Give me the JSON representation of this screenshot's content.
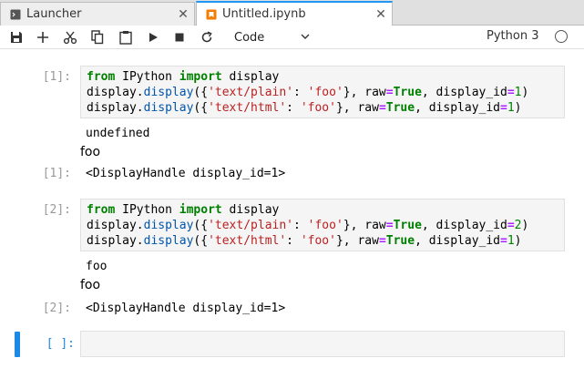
{
  "tabs": [
    {
      "label": "Launcher",
      "icon": "launcher-icon",
      "active": false
    },
    {
      "label": "Untitled.ipynb",
      "icon": "notebook-icon",
      "active": true
    }
  ],
  "toolbar": {
    "cell_type": "Code",
    "kernel_name": "Python 3"
  },
  "cells": [
    {
      "in_prompt": "[1]:",
      "code": [
        "from IPython import display",
        "display.display({'text/plain': 'foo'}, raw=True, display_id=1)",
        "display.display({'text/html': 'foo'}, raw=True, display_id=1)"
      ],
      "outputs": {
        "plain": "undefined",
        "html": "foo",
        "result_prompt": "[1]:",
        "result": "<DisplayHandle display_id=1>"
      }
    },
    {
      "in_prompt": "[2]:",
      "code": [
        "from IPython import display",
        "display.display({'text/plain': 'foo'}, raw=True, display_id=2)",
        "display.display({'text/html': 'foo'}, raw=True, display_id=1)"
      ],
      "outputs": {
        "plain": "foo",
        "html": "foo",
        "result_prompt": "[2]:",
        "result": "<DisplayHandle display_id=1>"
      }
    },
    {
      "in_prompt": "[ ]:",
      "code": []
    }
  ],
  "colors": {
    "accent": "#2196f3",
    "active_cell": "#1e88e5",
    "notebook_icon": "#f57c00"
  }
}
